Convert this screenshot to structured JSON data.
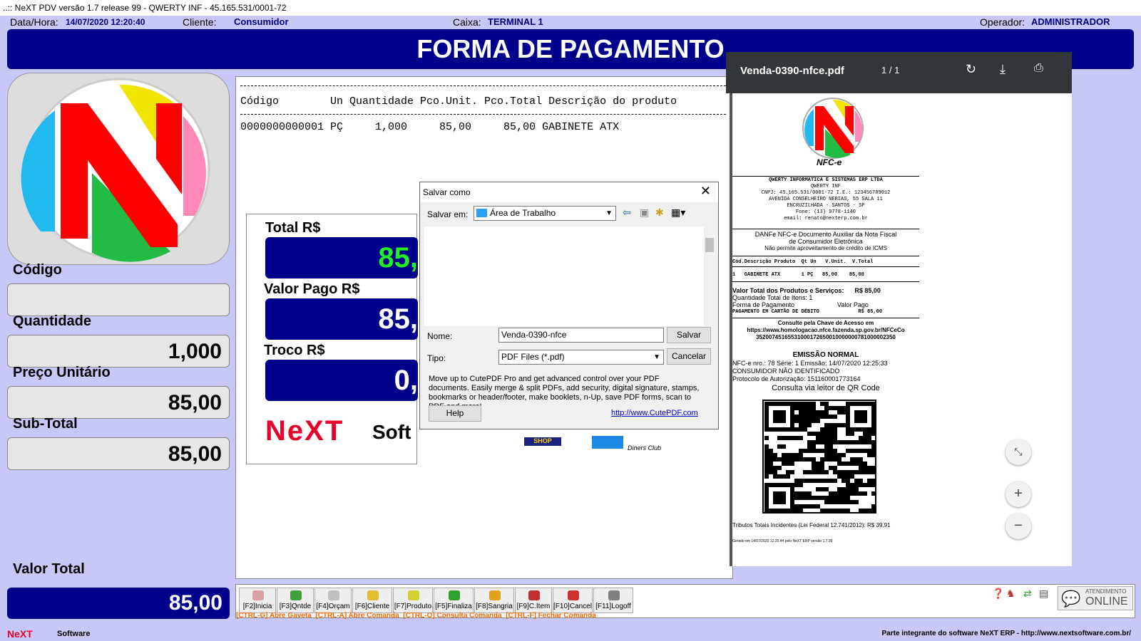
{
  "window": {
    "title": "..:: NeXT PDV versão 1.7 release 99 - QWERTY INF - 45.165.531/0001-72"
  },
  "info": {
    "datetime_label": "Data/Hora:",
    "datetime_value": "14/07/2020 12:20:40",
    "client_label": "Cliente:",
    "client_value": "Consumidor",
    "box_label": "Caixa:",
    "box_value": "TERMINAL 1",
    "operator_label": "Operador:",
    "operator_value": "ADMINISTRADOR"
  },
  "banner": "FORMA DE PAGAMENTO",
  "left": {
    "codigo_label": "Código",
    "codigo_value": "",
    "quantidade_label": "Quantidade",
    "quantidade_value": "1,000",
    "preco_label": "Preço Unitário",
    "preco_value": "85,00",
    "subtotal_label": "Sub-Total",
    "subtotal_value": "85,00",
    "valortotal_label": "Valor Total",
    "valortotal_value": "85,00"
  },
  "receipt": {
    "header": "Código        Un Quantidade Pco.Unit. Pco.Total Descrição do produto",
    "row": "0000000000001 PÇ     1,000     85,00     85,00 GABINETE ATX"
  },
  "totals": {
    "total_label": "Total R$",
    "total_value": "85,",
    "pago_label": "Valor Pago R$",
    "pago_value": "85,",
    "troco_label": "Troco R$",
    "troco_value": "0,",
    "brand_next": "NeXT",
    "brand_soft": "Soft",
    "card_diners": "Diners Club",
    "card_shop": "SHOP"
  },
  "dialog": {
    "title": "Salvar como",
    "save_in_label": "Salvar em:",
    "save_in_value": "Área de Trabalho",
    "name_label": "Nome:",
    "name_value": "Venda-0390-nfce",
    "type_label": "Tipo:",
    "type_value": "PDF Files (*.pdf)",
    "save_button": "Salvar",
    "cancel_button": "Cancelar",
    "help_button": "Help",
    "promo": "Move up to CutePDF Pro and get advanced control over your PDF documents. Easily merge & split PDFs, add security, digital signature, stamps, bookmarks or header/footer, make booklets, n-Up, save PDF forms, scan to PDF and more!",
    "link": "http://www.CutePDF.com"
  },
  "pdf": {
    "filename": "Venda-0390-nfce.pdf",
    "pages": "1 / 1",
    "nfce_label": "NFC-e",
    "company": "QWERTY INFORMATICA E SISTEMAS ERP LTDA",
    "company_short": "QWERTY INF",
    "cnpj": "CNPJ: 45.165.531/0001-72  I.E.: 123456789012",
    "address1": "AVENIDA CONSELHEIRO NEBIAS, 55 SALA 11",
    "address2": "ENCRUZILHADA - SANTOS - SP",
    "phone": "Fone: (13) 9778-1140",
    "email": "email: renato@nexterp.com.br",
    "danfe1": "DANFe NFC-e Documento Auxiliar da Nota Fiscal",
    "danfe2": "de Consumidor Eletrônica",
    "danfe3": "Não permite aproveitamento de crédito de ICMS",
    "cols": "Cód.Descrição Produto  Qt Un   V.Unit.  V.Total",
    "item": "1   GABINETE ATX       1 PÇ   85,00    85,00",
    "vtotal": "Valor Total dos Produtos e Serviços:      R$ 85,00",
    "qtd": "Quantidade Total de Itens: 1",
    "forma": "Forma de Pagamento                        Valor Pago",
    "cartao": "PAGAMENTO EM CARTÃO DE DÉBITO             R$ 85,00",
    "consulte": "Consulte pela Chave de Acesso em",
    "url": "https://www.homologacao.nfce.fazenda.sp.gov.br/NFCeCo",
    "chave": "35200745165531000172650010000000781000002350",
    "emissao": "EMISSÃO NORMAL",
    "nfce_no": "NFC-e nro.: 78 Série: 1 Emissão: 14/07/2020 12:25:33",
    "consumidor": "CONSUMIDOR NÃO IDENTIFICADO",
    "protocolo": "Protocolo de Autorização: 151160001773164",
    "qr_label": "Consulta via leitor de QR Code",
    "tributos": "Tributos Totais Incidentes (Lei Federal 12.741/2012): R$ 39,91",
    "gerado": "Gerado em 14/07/2020 12:25:44 pelo NeXT ERP versão 1.7.99"
  },
  "toolbar": {
    "buttons": [
      "[F2]Inicia",
      "[F3]Qntde",
      "[F4]Orçam",
      "[F6]Cliente",
      "[F7]Produto",
      "[F5]Finaliza",
      "[F8]Sangria",
      "[F9]C.Item",
      "[F10]Cancel",
      "[F11]Logoff"
    ],
    "shortcuts": "[CTRL-G] Abre Gaveta  [CTRL-A] Abre Comanda  [CTRL-O] Consulta Comanda  [CTRL-F] Fechar Comanda",
    "atendimento": "ATENDIMENTO",
    "online": "ONLINE"
  },
  "footer": {
    "brand_next": "NeXT",
    "brand_soft": "Software",
    "right": "Parte integrante do software NeXT ERP - http://www.nextsoftware.com.br/"
  },
  "colors": {
    "navy": "#00008b",
    "green_value": "#22ee22",
    "orange": "#ff6600"
  }
}
